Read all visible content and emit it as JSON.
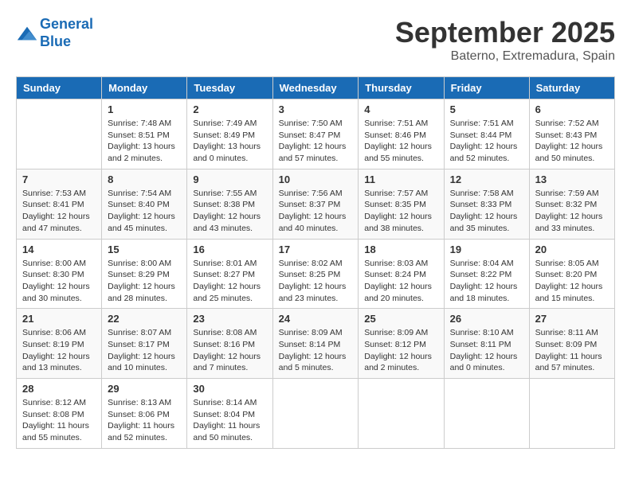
{
  "header": {
    "logo_line1": "General",
    "logo_line2": "Blue",
    "month_title": "September 2025",
    "location": "Baterno, Extremadura, Spain"
  },
  "days_of_week": [
    "Sunday",
    "Monday",
    "Tuesday",
    "Wednesday",
    "Thursday",
    "Friday",
    "Saturday"
  ],
  "weeks": [
    [
      {
        "num": "",
        "info": ""
      },
      {
        "num": "1",
        "info": "Sunrise: 7:48 AM\nSunset: 8:51 PM\nDaylight: 13 hours\nand 2 minutes."
      },
      {
        "num": "2",
        "info": "Sunrise: 7:49 AM\nSunset: 8:49 PM\nDaylight: 13 hours\nand 0 minutes."
      },
      {
        "num": "3",
        "info": "Sunrise: 7:50 AM\nSunset: 8:47 PM\nDaylight: 12 hours\nand 57 minutes."
      },
      {
        "num": "4",
        "info": "Sunrise: 7:51 AM\nSunset: 8:46 PM\nDaylight: 12 hours\nand 55 minutes."
      },
      {
        "num": "5",
        "info": "Sunrise: 7:51 AM\nSunset: 8:44 PM\nDaylight: 12 hours\nand 52 minutes."
      },
      {
        "num": "6",
        "info": "Sunrise: 7:52 AM\nSunset: 8:43 PM\nDaylight: 12 hours\nand 50 minutes."
      }
    ],
    [
      {
        "num": "7",
        "info": "Sunrise: 7:53 AM\nSunset: 8:41 PM\nDaylight: 12 hours\nand 47 minutes."
      },
      {
        "num": "8",
        "info": "Sunrise: 7:54 AM\nSunset: 8:40 PM\nDaylight: 12 hours\nand 45 minutes."
      },
      {
        "num": "9",
        "info": "Sunrise: 7:55 AM\nSunset: 8:38 PM\nDaylight: 12 hours\nand 43 minutes."
      },
      {
        "num": "10",
        "info": "Sunrise: 7:56 AM\nSunset: 8:37 PM\nDaylight: 12 hours\nand 40 minutes."
      },
      {
        "num": "11",
        "info": "Sunrise: 7:57 AM\nSunset: 8:35 PM\nDaylight: 12 hours\nand 38 minutes."
      },
      {
        "num": "12",
        "info": "Sunrise: 7:58 AM\nSunset: 8:33 PM\nDaylight: 12 hours\nand 35 minutes."
      },
      {
        "num": "13",
        "info": "Sunrise: 7:59 AM\nSunset: 8:32 PM\nDaylight: 12 hours\nand 33 minutes."
      }
    ],
    [
      {
        "num": "14",
        "info": "Sunrise: 8:00 AM\nSunset: 8:30 PM\nDaylight: 12 hours\nand 30 minutes."
      },
      {
        "num": "15",
        "info": "Sunrise: 8:00 AM\nSunset: 8:29 PM\nDaylight: 12 hours\nand 28 minutes."
      },
      {
        "num": "16",
        "info": "Sunrise: 8:01 AM\nSunset: 8:27 PM\nDaylight: 12 hours\nand 25 minutes."
      },
      {
        "num": "17",
        "info": "Sunrise: 8:02 AM\nSunset: 8:25 PM\nDaylight: 12 hours\nand 23 minutes."
      },
      {
        "num": "18",
        "info": "Sunrise: 8:03 AM\nSunset: 8:24 PM\nDaylight: 12 hours\nand 20 minutes."
      },
      {
        "num": "19",
        "info": "Sunrise: 8:04 AM\nSunset: 8:22 PM\nDaylight: 12 hours\nand 18 minutes."
      },
      {
        "num": "20",
        "info": "Sunrise: 8:05 AM\nSunset: 8:20 PM\nDaylight: 12 hours\nand 15 minutes."
      }
    ],
    [
      {
        "num": "21",
        "info": "Sunrise: 8:06 AM\nSunset: 8:19 PM\nDaylight: 12 hours\nand 13 minutes."
      },
      {
        "num": "22",
        "info": "Sunrise: 8:07 AM\nSunset: 8:17 PM\nDaylight: 12 hours\nand 10 minutes."
      },
      {
        "num": "23",
        "info": "Sunrise: 8:08 AM\nSunset: 8:16 PM\nDaylight: 12 hours\nand 7 minutes."
      },
      {
        "num": "24",
        "info": "Sunrise: 8:09 AM\nSunset: 8:14 PM\nDaylight: 12 hours\nand 5 minutes."
      },
      {
        "num": "25",
        "info": "Sunrise: 8:09 AM\nSunset: 8:12 PM\nDaylight: 12 hours\nand 2 minutes."
      },
      {
        "num": "26",
        "info": "Sunrise: 8:10 AM\nSunset: 8:11 PM\nDaylight: 12 hours\nand 0 minutes."
      },
      {
        "num": "27",
        "info": "Sunrise: 8:11 AM\nSunset: 8:09 PM\nDaylight: 11 hours\nand 57 minutes."
      }
    ],
    [
      {
        "num": "28",
        "info": "Sunrise: 8:12 AM\nSunset: 8:08 PM\nDaylight: 11 hours\nand 55 minutes."
      },
      {
        "num": "29",
        "info": "Sunrise: 8:13 AM\nSunset: 8:06 PM\nDaylight: 11 hours\nand 52 minutes."
      },
      {
        "num": "30",
        "info": "Sunrise: 8:14 AM\nSunset: 8:04 PM\nDaylight: 11 hours\nand 50 minutes."
      },
      {
        "num": "",
        "info": ""
      },
      {
        "num": "",
        "info": ""
      },
      {
        "num": "",
        "info": ""
      },
      {
        "num": "",
        "info": ""
      }
    ]
  ]
}
